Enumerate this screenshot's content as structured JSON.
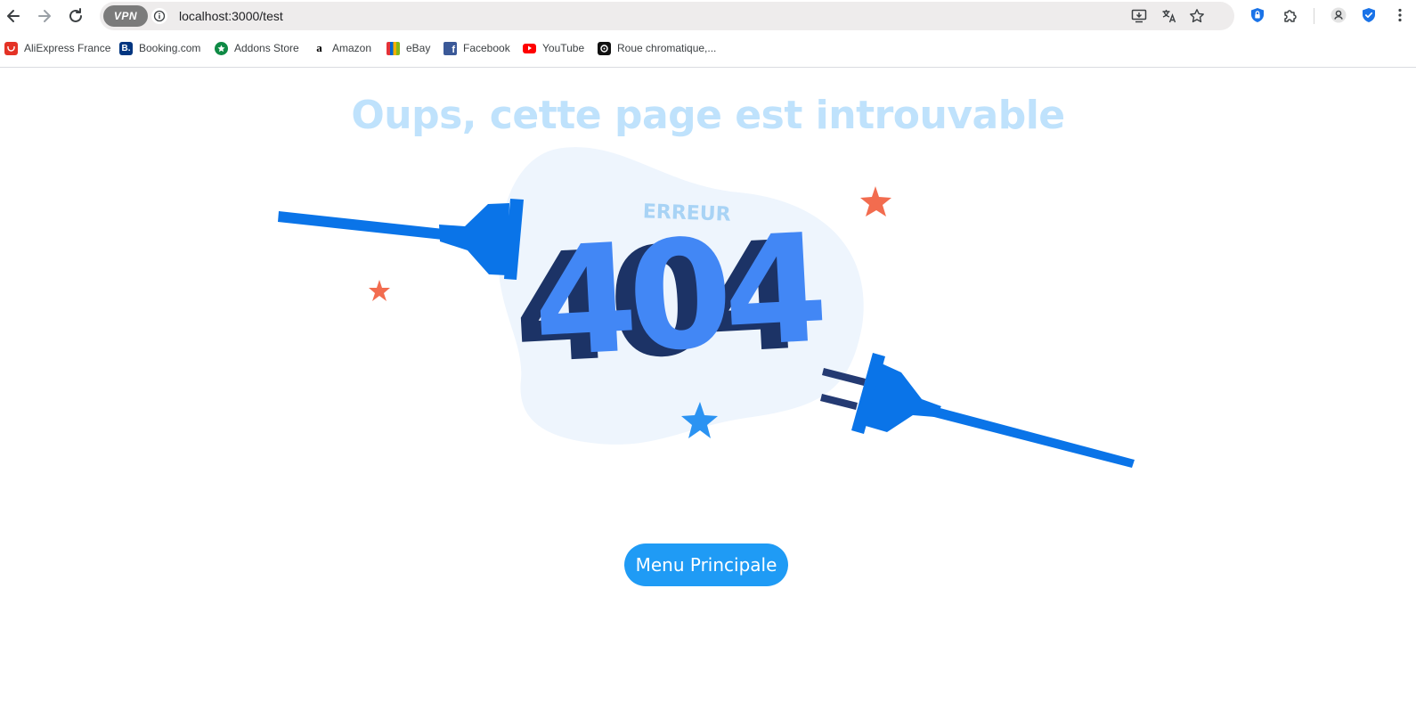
{
  "browser": {
    "vpn_label": "VPN",
    "url": "localhost:3000/test",
    "bookmarks": [
      {
        "label": "AliExpress France",
        "icon": "aliexpress-icon",
        "color": "#e43225"
      },
      {
        "label": "Booking.com",
        "icon": "booking-icon",
        "color": "#003580"
      },
      {
        "label": "Addons Store",
        "icon": "addons-icon",
        "color": "#0f8a45"
      },
      {
        "label": "Amazon",
        "icon": "amazon-icon",
        "color": "#000000"
      },
      {
        "label": "eBay",
        "icon": "ebay-icon",
        "color": "#e53238"
      },
      {
        "label": "Facebook",
        "icon": "facebook-icon",
        "color": "#3b5998"
      },
      {
        "label": "YouTube",
        "icon": "youtube-icon",
        "color": "#ff0000"
      },
      {
        "label": "Roue chromatique,...",
        "icon": "color-wheel-icon",
        "color": "#111111"
      }
    ]
  },
  "page": {
    "headline": "Oups, cette page est introuvable",
    "error_label": "ERREUR",
    "error_code": "404",
    "home_button": "Menu Principale"
  },
  "colors": {
    "headline": "#bfe2fc",
    "plug_blue": "#0a74e8",
    "digits_front": "#4287f5",
    "digits_side": "#1c3366",
    "blob": "#eef5fd",
    "star_orange": "#f26c4f",
    "star_blue": "#2b93f2",
    "button": "#1f9bf5"
  }
}
